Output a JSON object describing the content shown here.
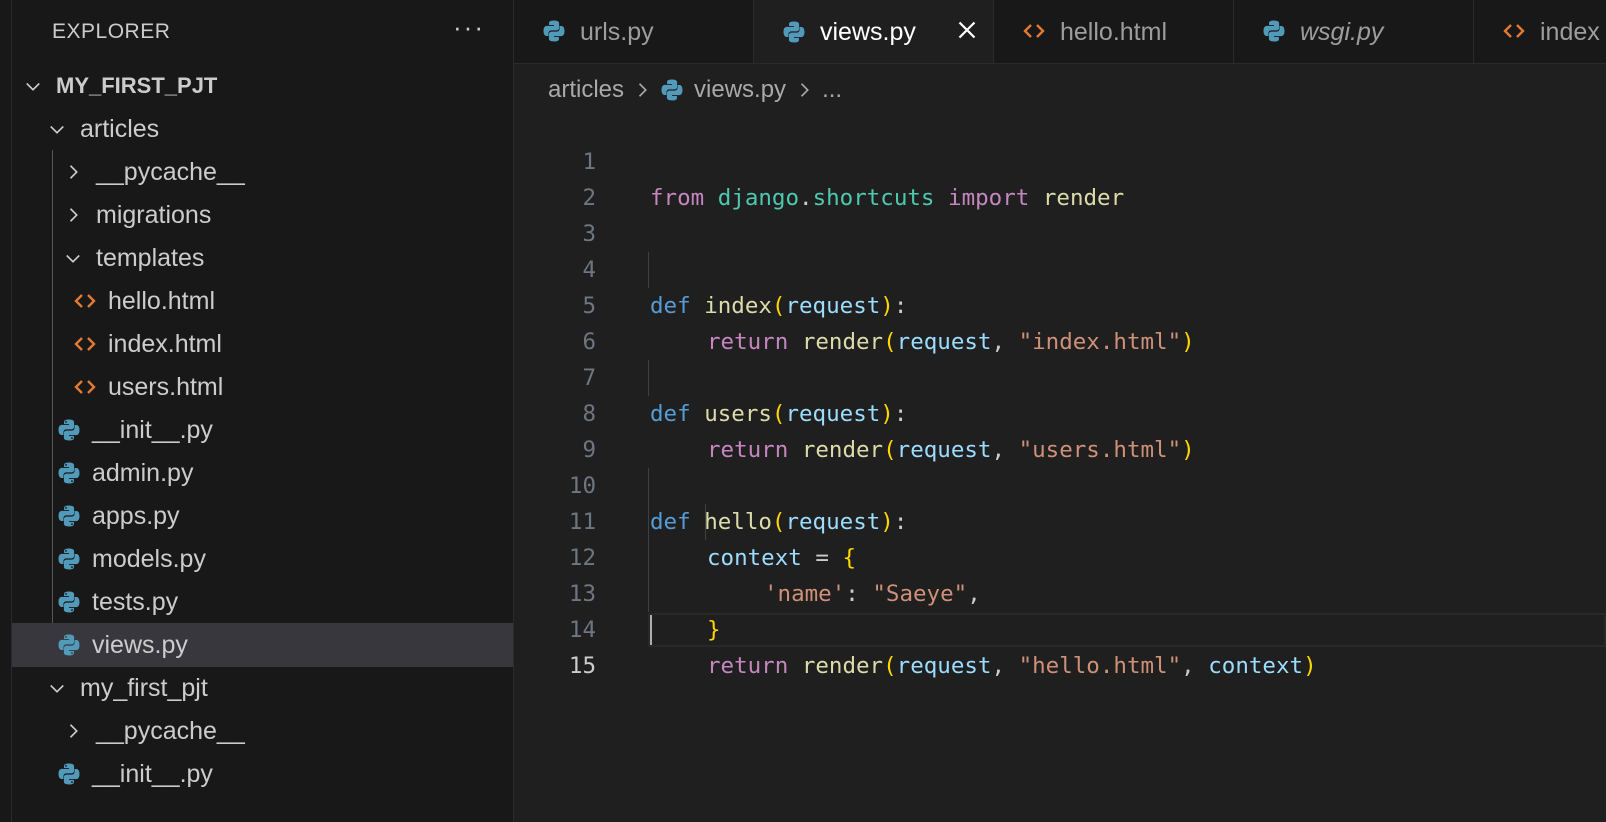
{
  "explorer": {
    "title": "EXPLORER",
    "more": "···",
    "tree": [
      {
        "label": "MY_FIRST_PJT",
        "type": "root",
        "state": "expanded"
      },
      {
        "label": "articles",
        "type": "folder",
        "state": "expanded"
      },
      {
        "label": "__pycache__",
        "type": "folder",
        "state": "collapsed"
      },
      {
        "label": "migrations",
        "type": "folder",
        "state": "collapsed"
      },
      {
        "label": "templates",
        "type": "folder",
        "state": "expanded"
      },
      {
        "label": "hello.html",
        "type": "html"
      },
      {
        "label": "index.html",
        "type": "html"
      },
      {
        "label": "users.html",
        "type": "html"
      },
      {
        "label": "__init__.py",
        "type": "python"
      },
      {
        "label": "admin.py",
        "type": "python"
      },
      {
        "label": "apps.py",
        "type": "python"
      },
      {
        "label": "models.py",
        "type": "python"
      },
      {
        "label": "tests.py",
        "type": "python"
      },
      {
        "label": "views.py",
        "type": "python",
        "selected": true
      },
      {
        "label": "my_first_pjt",
        "type": "folder",
        "state": "expanded"
      },
      {
        "label": "__pycache__",
        "type": "folder",
        "state": "collapsed"
      },
      {
        "label": "__init__.py",
        "type": "python"
      }
    ]
  },
  "tabs": [
    {
      "label": "urls.py",
      "icon": "python-icon"
    },
    {
      "label": "views.py",
      "icon": "python-icon",
      "active": true
    },
    {
      "label": "hello.html",
      "icon": "html-icon"
    },
    {
      "label": "wsgi.py",
      "icon": "python-icon",
      "preview": true
    },
    {
      "label": "index",
      "icon": "html-icon"
    }
  ],
  "breadcrumb": {
    "folder": "articles",
    "file": "views.py",
    "ellipsis": "..."
  },
  "code": {
    "line_numbers": [
      "1",
      "2",
      "3",
      "4",
      "5",
      "6",
      "7",
      "8",
      "9",
      "10",
      "11",
      "12",
      "13",
      "14",
      "15"
    ],
    "active_line": "15",
    "l1": {
      "kw_from": "from",
      "module_a": "django",
      "dot": ".",
      "module_b": "shortcuts",
      "kw_import": "import",
      "name": "render"
    },
    "l4": {
      "kw": "def",
      "fn": "index",
      "open": "(",
      "param": "request",
      "close": ")",
      "colon": ":"
    },
    "l5": {
      "kw": "return",
      "fn": "render",
      "open": "(",
      "arg": "request",
      "comma": ", ",
      "str": "\"index.html\"",
      "close": ")"
    },
    "l7": {
      "kw": "def",
      "fn": "users",
      "open": "(",
      "param": "request",
      "close": ")",
      "colon": ":"
    },
    "l8": {
      "kw": "return",
      "fn": "render",
      "open": "(",
      "arg": "request",
      "comma": ", ",
      "str": "\"users.html\"",
      "close": ")"
    },
    "l10": {
      "kw": "def",
      "fn": "hello",
      "open": "(",
      "param": "request",
      "close": ")",
      "colon": ":"
    },
    "l11": {
      "var": "context",
      "eq": " = ",
      "brace": "{"
    },
    "l12": {
      "key": "'name'",
      "colon": ": ",
      "val": "\"Saeye\"",
      "comma": ","
    },
    "l13": {
      "brace": "}"
    },
    "l14": {
      "kw": "return",
      "fn": "render",
      "open": "(",
      "arg": "request",
      "comma": ", ",
      "str": "\"hello.html\"",
      "comma2": ", ",
      "arg2": "context",
      "close": ")"
    }
  },
  "colors": {
    "background": "#1f1f1f",
    "sidebar": "#181818",
    "selection": "#37373d",
    "python_icon": "#519aba",
    "html_icon": "#e37933"
  }
}
